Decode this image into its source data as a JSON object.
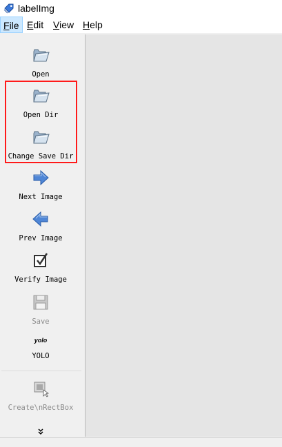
{
  "window": {
    "title": "labelImg",
    "icon": "tag-icon"
  },
  "menu": [
    {
      "underline": "F",
      "rest": "ile"
    },
    {
      "underline": "E",
      "rest": "dit"
    },
    {
      "underline": "V",
      "rest": "iew"
    },
    {
      "underline": "H",
      "rest": "elp"
    }
  ],
  "toolbar": {
    "open": {
      "label": "Open",
      "icon": "folder-open-icon"
    },
    "open_dir": {
      "label": "Open Dir",
      "icon": "folder-open-icon"
    },
    "change_save_dir": {
      "label": "Change Save Dir",
      "icon": "folder-open-icon"
    },
    "next_image": {
      "label": "Next Image",
      "icon": "arrow-right-icon"
    },
    "prev_image": {
      "label": "Prev Image",
      "icon": "arrow-left-icon"
    },
    "verify_image": {
      "label": "Verify Image",
      "icon": "checkbox-icon"
    },
    "save": {
      "label": "Save",
      "icon": "floppy-disk-icon",
      "disabled": true
    },
    "format": {
      "icon_text": "yolo",
      "label": "YOLO"
    },
    "create_rect": {
      "label": "Create\\nRectBox",
      "icon": "draw-rect-icon",
      "disabled": true
    },
    "more_icon": "double-chevron-down-icon"
  },
  "annotation": {
    "highlight_color": "#ff1a1a"
  },
  "colors": {
    "canvas": "#e5e5e5",
    "toolbar": "#f0f0f0",
    "menu_selected": "#cce8ff"
  }
}
